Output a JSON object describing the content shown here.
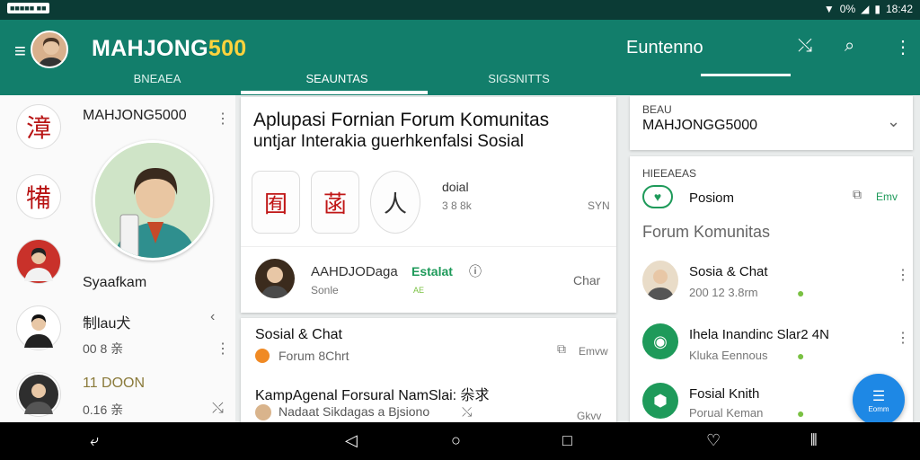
{
  "status_bar": {
    "badge": "■■■■■ ■■",
    "time": "18:42",
    "icons": [
      "notification-icon",
      "wifi-icon",
      "signal-icon",
      "battery-icon"
    ],
    "percent": "0%"
  },
  "app_bar": {
    "title_main": "MAHJONG",
    "title_accent": "500",
    "tabs": [
      "BNEAEA",
      "SEAUNTAS",
      "SIGSNITTS"
    ],
    "right_title": "Euntenno"
  },
  "left": {
    "items": [
      {
        "glyph": "漳",
        "title": "MAHJONG5000"
      },
      {
        "glyph": "犕"
      },
      {
        "title": "Syaafkam"
      },
      {
        "title": "制lau犬",
        "sub": "00 8 亲"
      },
      {
        "title": "11 DOON",
        "sub": "0.16 亲"
      }
    ]
  },
  "middle": {
    "title": "Aplupasi Fornian Forum Komunitas",
    "subtitle": "untjar Interakia guerhkenfalsi Sosial",
    "tiles": [
      "囿",
      "菡",
      "人"
    ],
    "tile_info": {
      "label": "doial",
      "sub": "3 8 8k",
      "meta": "SYN"
    },
    "row1": {
      "name": "AAHDJODaga",
      "tag": "Estalat",
      "sub": "Sonle",
      "sub2": "AE",
      "meta": "Char"
    },
    "card2": {
      "title": "Sosial & Chat",
      "sub": "Forum 8Chrt",
      "meta": "Emvw",
      "title2": "KampAgenal Forsural NamSlai: 尜求",
      "sub2": "Nadaat Sikdagas a Bjsiono",
      "meta2": "Gkvv"
    }
  },
  "right": {
    "select_label": "BEAU",
    "select_value": "MAHJONGG5000",
    "section_label": "HIEEAEAS",
    "posiom": "Posiom",
    "posiom_meta": "Emv",
    "forum_title": "Forum Komunitas",
    "items": [
      {
        "title": "Sosia & Chat",
        "sub": "200 12 3.8rm"
      },
      {
        "title": "Ihela Inandinc Slar2 4N",
        "sub": "Kluka Eennous"
      },
      {
        "title": "Fosial Knith",
        "sub": "Porual Keman"
      }
    ],
    "fab_label": "Eomm"
  },
  "colors": {
    "primary": "#127e6b",
    "accent": "#ffd33d",
    "green": "#1e9a5a",
    "fab": "#1e88e5"
  }
}
